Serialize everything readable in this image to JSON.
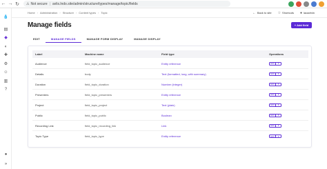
{
  "browser": {
    "security_label": "Not secure",
    "url": "avlis.lndo.site/admin/structure/types/manage/topic/fields"
  },
  "breadcrumb": [
    "Home",
    "Administration",
    "Structure",
    "Content types",
    "Topic"
  ],
  "top_actions": {
    "back": "Back to site",
    "shortcuts": "Shortcuts",
    "user": "lacadmin"
  },
  "page": {
    "title": "Manage fields",
    "add_button": "+ Add field"
  },
  "tabs": [
    {
      "label": "EDIT",
      "active": false
    },
    {
      "label": "MANAGE FIELDS",
      "active": true
    },
    {
      "label": "MANAGE FORM DISPLAY",
      "active": false
    },
    {
      "label": "MANAGE DISPLAY",
      "active": false
    }
  ],
  "table": {
    "headers": [
      "Label",
      "Machine name",
      "Field type",
      "Operations"
    ],
    "rows": [
      {
        "label": "Audience",
        "machine": "field_topic_audience",
        "type": "Entity reference",
        "op": "Edit"
      },
      {
        "label": "Details",
        "machine": "body",
        "type": "Text (formatted, long, with summary)",
        "op": "Edit"
      },
      {
        "label": "Duration",
        "machine": "field_topic_duration",
        "type": "Number (integer)",
        "op": "Edit"
      },
      {
        "label": "Presenters",
        "machine": "field_topic_presenters",
        "type": "Entity reference",
        "op": "Edit"
      },
      {
        "label": "Project",
        "machine": "field_topic_project",
        "type": "Text (plain)",
        "op": "Edit"
      },
      {
        "label": "Public",
        "machine": "field_topic_public",
        "type": "Boolean",
        "op": "Edit"
      },
      {
        "label": "Recording Link",
        "machine": "field_topic_recording_link",
        "type": "Link",
        "op": "Edit"
      },
      {
        "label": "Topic Type",
        "machine": "field_topic_type",
        "type": "Entity reference",
        "op": "Edit"
      }
    ]
  },
  "colors": {
    "accent": "#5b2ad6"
  }
}
